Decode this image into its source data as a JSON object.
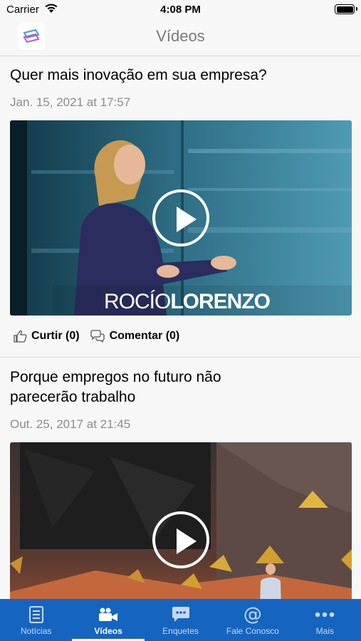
{
  "status_bar": {
    "carrier": "Carrier",
    "time": "4:08 PM"
  },
  "header": {
    "title": "Vídeos"
  },
  "posts": [
    {
      "title": "Quer mais inovação em sua empresa?",
      "date": "Jan. 15, 2021 at 17:57",
      "overlay_text_light": "ROCÍO",
      "overlay_text_bold": "LORENZO",
      "like_label": "Curtir (0)",
      "comment_label": "Comentar (0)"
    },
    {
      "title": "Porque empregos no futuro não parecerão trabalho",
      "date": "Out. 25, 2017 at 21:45"
    }
  ],
  "tabbar": {
    "items": [
      {
        "label": "Notícias",
        "icon": "newspaper-icon"
      },
      {
        "label": "Vídeos",
        "icon": "video-camera-icon",
        "active": true
      },
      {
        "label": "Enquetes",
        "icon": "chat-bubble-icon"
      },
      {
        "label": "Fale Conosco",
        "icon": "at-sign-icon"
      },
      {
        "label": "Mais",
        "icon": "more-dots-icon"
      }
    ]
  },
  "colors": {
    "tabbar": "#1565c0",
    "background": "#f7f7f7",
    "date_text": "#8c8c8c"
  }
}
